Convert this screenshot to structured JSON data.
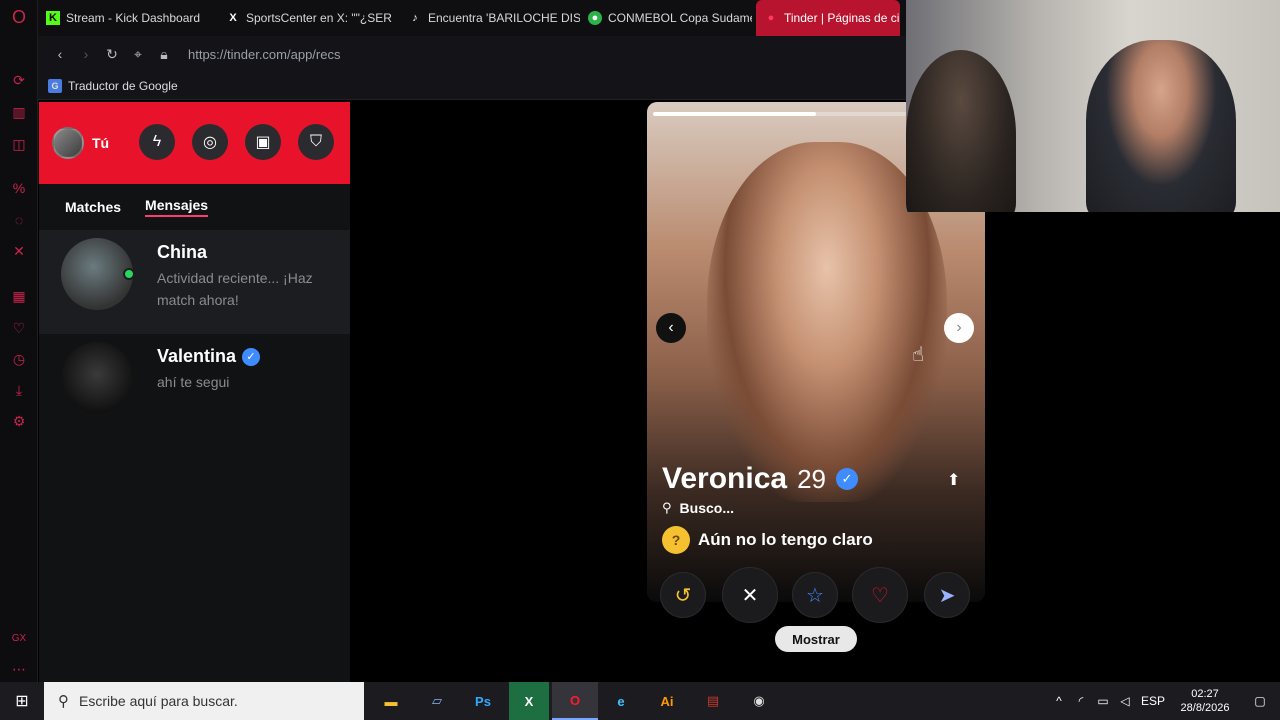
{
  "browser": {
    "tabs": [
      {
        "label": "Stream - Kick Dashboard",
        "icon": "kick-icon"
      },
      {
        "label": "SportsCenter en X: \"\"¿SER",
        "icon": "x-icon"
      },
      {
        "label": "Encuentra 'BARILOCHE DIS",
        "icon": "tiktok-icon"
      },
      {
        "label": "CONMEBOL Copa Sudame",
        "icon": "conmebol-icon"
      },
      {
        "label": "Tinder | Páginas de ci",
        "icon": "tinder-icon"
      }
    ],
    "url": "https://tinder.com/app/recs",
    "bookmark": "Traductor de Google"
  },
  "tinder": {
    "profile_label": "Tú",
    "tabs": {
      "matches": "Matches",
      "mensajes": "Mensajes"
    },
    "messages": [
      {
        "name": "China",
        "snippet": "Actividad reciente... ¡Haz match ahora!"
      },
      {
        "name": "Valentina",
        "snippet": "ahí te segui"
      }
    ],
    "card": {
      "name": "Veronica",
      "age": "29",
      "busco_label": "Busco...",
      "intent": "Aún no lo tengo claro",
      "photo_progress": 0.5
    },
    "mostrar_label": "Mostrar"
  },
  "taskbar": {
    "search_placeholder": "Escribe aquí para buscar.",
    "lang": "ESP",
    "time": "02:27",
    "date": "28/8/2026"
  }
}
